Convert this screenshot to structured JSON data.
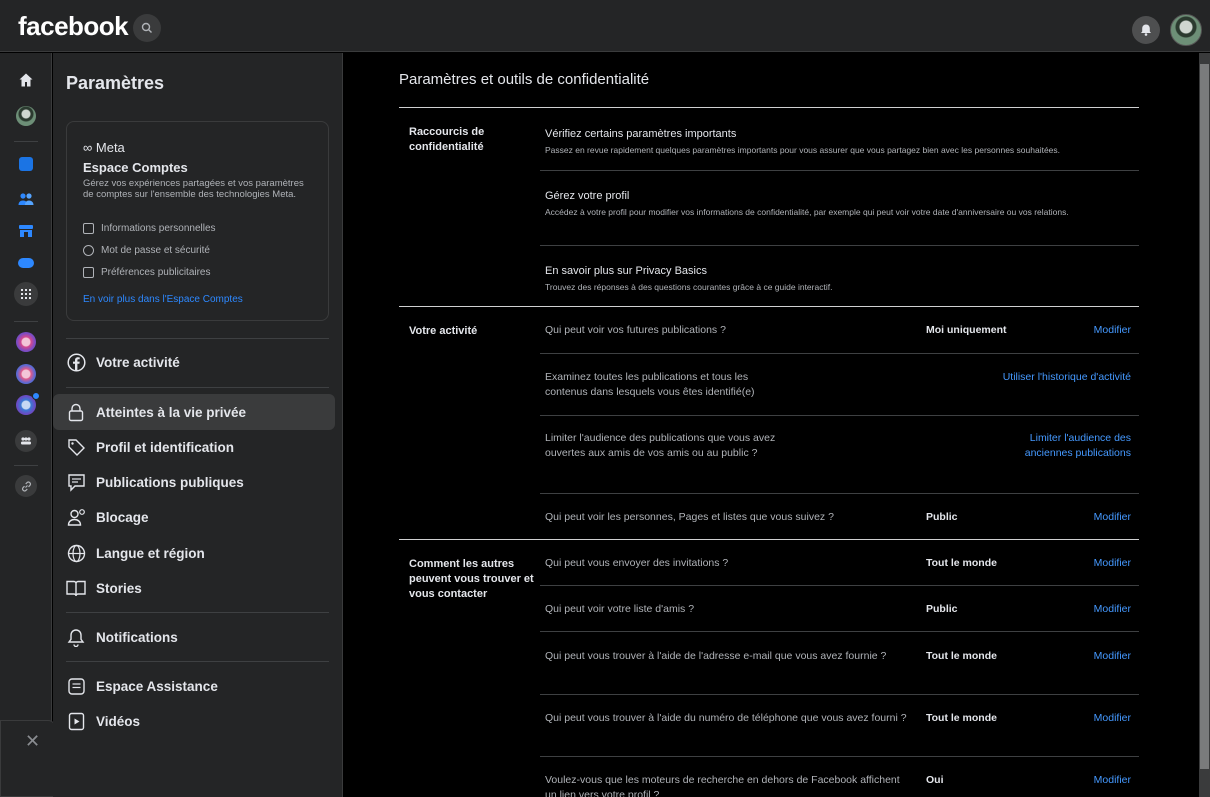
{
  "topbar": {
    "logo": "facebook",
    "search_icon": "search-icon",
    "notifications_icon": "bell-icon"
  },
  "sidebar": {
    "title": "Paramètres",
    "accounts_center": {
      "brand": "∞ Meta",
      "title": "Espace Comptes",
      "description": "Gérez vos expériences partagées et vos paramètres de comptes sur l'ensemble des technologies Meta.",
      "links": [
        {
          "label": "Informations personnelles",
          "icon": "id-card-icon"
        },
        {
          "label": "Mot de passe et sécurité",
          "icon": "shield-icon"
        },
        {
          "label": "Préférences publicitaires",
          "icon": "ad-icon"
        }
      ],
      "more_link": "En voir plus dans l'Espace Comptes"
    },
    "items": [
      {
        "label": "Votre activité",
        "icon": "facebook-icon"
      },
      {
        "label": "Atteintes à la vie privée",
        "icon": "lock-icon"
      },
      {
        "label": "Profil et identification",
        "icon": "tag-icon"
      },
      {
        "label": "Publications publiques",
        "icon": "public-post-icon"
      },
      {
        "label": "Blocage",
        "icon": "block-user-icon"
      },
      {
        "label": "Langue et région",
        "icon": "globe-icon"
      },
      {
        "label": "Stories",
        "icon": "book-icon"
      },
      {
        "label": "Notifications",
        "icon": "bell-icon"
      },
      {
        "label": "Espace Assistance",
        "icon": "support-icon"
      },
      {
        "label": "Vidéos",
        "icon": "video-icon"
      }
    ]
  },
  "main": {
    "title": "Paramètres et outils de confidentialité",
    "shortcuts": {
      "label": "Raccourcis de confidentialité",
      "rows": [
        {
          "title": "Vérifiez certains paramètres importants",
          "desc": "Passez en revue rapidement quelques paramètres importants pour vous assurer que vous partagez bien avec les personnes souhaitées."
        },
        {
          "title": "Gérez votre profil",
          "desc": "Accédez à votre profil pour modifier vos informations de confidentialité, par exemple qui peut voir votre date d'anniversaire ou vos relations."
        },
        {
          "title": "En savoir plus sur Privacy Basics",
          "desc": "Trouvez des réponses à des questions courantes grâce à ce guide interactif."
        }
      ]
    },
    "activity": {
      "label": "Votre activité",
      "rows": [
        {
          "question": "Qui peut voir vos futures publications ?",
          "value": "Moi uniquement",
          "action": "Modifier"
        },
        {
          "question": "Examinez toutes les publications et tous les contenus dans lesquels vous êtes identifié(e)",
          "value": "",
          "action": "Utiliser l'historique d'activité"
        },
        {
          "question": "Limiter l'audience des publications que vous avez ouvertes aux amis de vos amis ou au public ?",
          "value": "",
          "action": "Limiter l'audience des anciennes publications"
        },
        {
          "question": "Qui peut voir les personnes, Pages et listes que vous suivez ?",
          "value": "Public",
          "action": "Modifier"
        }
      ]
    },
    "contact": {
      "label": "Comment les autres peuvent vous trouver et vous contacter",
      "rows": [
        {
          "question": "Qui peut vous envoyer des invitations ?",
          "value": "Tout le monde",
          "action": "Modifier"
        },
        {
          "question": "Qui peut voir votre liste d'amis ?",
          "value": "Public",
          "action": "Modifier"
        },
        {
          "question": "Qui peut vous trouver à l'aide de l'adresse e-mail que vous avez fournie ?",
          "value": "Tout le monde",
          "action": "Modifier"
        },
        {
          "question": "Qui peut vous trouver à l'aide du numéro de téléphone que vous avez fourni ?",
          "value": "Tout le monde",
          "action": "Modifier"
        },
        {
          "question": "Voulez-vous que les moteurs de recherche en dehors de Facebook affichent un lien vers votre profil ?",
          "value": "Oui",
          "action": "Modifier"
        }
      ]
    }
  },
  "colors": {
    "accent": "#2d88ff",
    "link": "#4599ff",
    "surface": "#242526",
    "background": "#000000"
  }
}
